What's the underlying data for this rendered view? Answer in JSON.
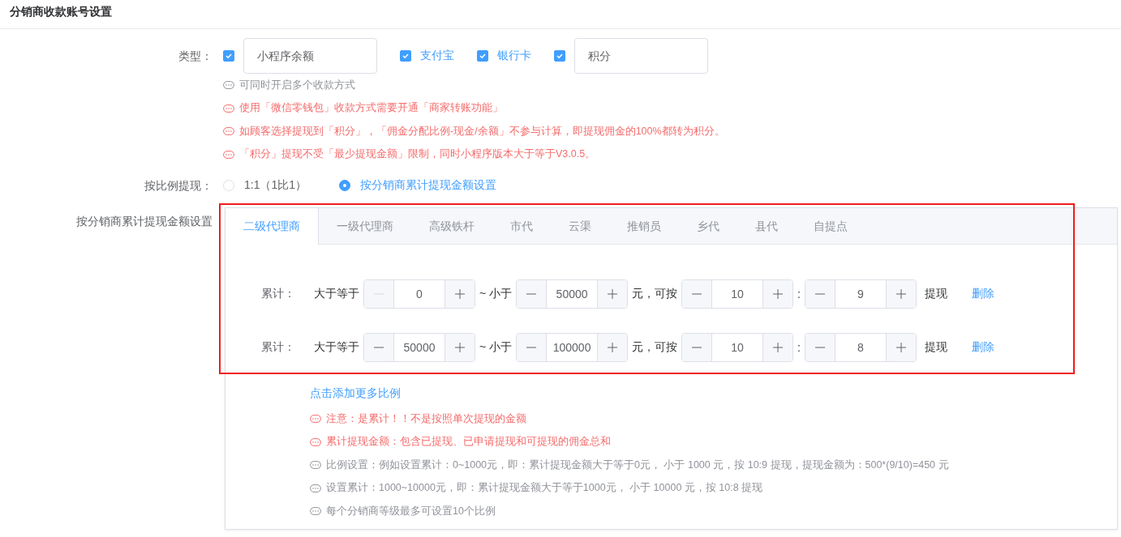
{
  "title": "分销商收款账号设置",
  "type_field": {
    "label": "类型：",
    "options": [
      {
        "kind": "input",
        "label": "小程序余额",
        "checked": true
      },
      {
        "kind": "label",
        "label": "支付宝",
        "checked": true
      },
      {
        "kind": "label",
        "label": "银行卡",
        "checked": true
      },
      {
        "kind": "input",
        "label": "积分",
        "checked": true
      }
    ],
    "hints": [
      {
        "kind": "info",
        "text": "可同时开启多个收款方式"
      },
      {
        "kind": "warning",
        "text": "使用「微信零钱包」收款方式需要开通「商家转账功能」"
      },
      {
        "kind": "warning",
        "text": "如顾客选择提现到「积分」，「佣金分配比例-现金/余额」不参与计算，即提现佣金的100%都转为积分。"
      },
      {
        "kind": "warning",
        "text": "「积分」提现不受「最少提现金额」限制，同时小程序版本大于等于V3.0.5。"
      }
    ]
  },
  "ratio_field": {
    "label": "按比例提现：",
    "options": [
      {
        "label": "1:1（1比1）",
        "selected": false
      },
      {
        "label": "按分销商累计提现金额设置",
        "selected": true
      }
    ]
  },
  "tiers_field": {
    "label": "按分销商累计提现金额设置",
    "tabs": [
      {
        "label": "二级代理商",
        "selected": true
      },
      {
        "label": "一级代理商",
        "selected": false
      },
      {
        "label": "高级铁杆",
        "selected": false
      },
      {
        "label": "市代",
        "selected": false
      },
      {
        "label": "云渠",
        "selected": false
      },
      {
        "label": "推销员",
        "selected": false
      },
      {
        "label": "乡代",
        "selected": false
      },
      {
        "label": "县代",
        "selected": false
      },
      {
        "label": "自提点",
        "selected": false
      }
    ],
    "rows": [
      {
        "label": "累计：",
        "from_label": "大于等于",
        "from": {
          "value": "0",
          "minus_disabled": true
        },
        "to_label": "~ 小于",
        "to": {
          "value": "50000",
          "minus_disabled": false
        },
        "ratio_label": "元，可按",
        "ratio_a": {
          "value": "10",
          "minus_disabled": false
        },
        "colon": ":",
        "ratio_b": {
          "value": "9",
          "minus_disabled": false
        },
        "suffix": "提现",
        "delete": "删除"
      },
      {
        "label": "累计：",
        "from_label": "大于等于",
        "from": {
          "value": "50000",
          "minus_disabled": false
        },
        "to_label": "~ 小于",
        "to": {
          "value": "100000",
          "minus_disabled": false
        },
        "ratio_label": "元，可按",
        "ratio_a": {
          "value": "10",
          "minus_disabled": false
        },
        "colon": ":",
        "ratio_b": {
          "value": "8",
          "minus_disabled": false
        },
        "suffix": "提现",
        "delete": "删除"
      }
    ],
    "add_link": "点击添加更多比例",
    "notes": [
      {
        "kind": "warning",
        "text": "注意：是累计！！不是按照单次提现的金额"
      },
      {
        "kind": "warning",
        "text": "累计提现金额：包含已提现、已申请提现和可提现的佣金总和"
      },
      {
        "kind": "info",
        "text": "比例设置：例如设置累计：0~1000元，即：累计提现金额大于等于0元， 小于 1000 元，按 10:9 提现，提现金额为：500*(9/10)=450 元"
      },
      {
        "kind": "info",
        "text": "设置累计：1000~10000元，即：累计提现金额大于等于1000元， 小于 10000 元，按 10:8 提现"
      },
      {
        "kind": "info",
        "text": "每个分销商等级最多可设置10个比例"
      }
    ]
  }
}
